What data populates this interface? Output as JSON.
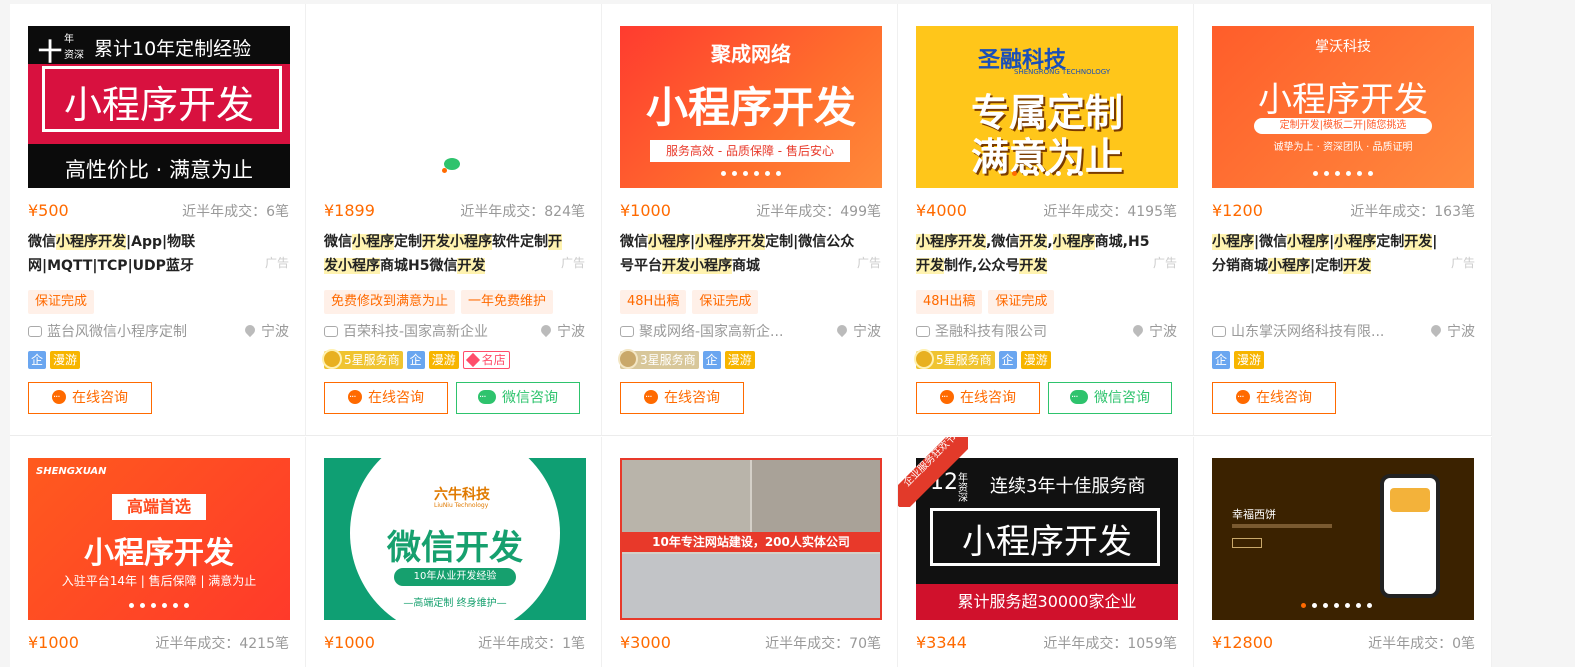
{
  "colors": {
    "accent": "#ff6a00",
    "wechat": "#2ec36d",
    "highlight": "#fff3b0"
  },
  "labels": {
    "deals_prefix": "近半年成交：",
    "ad": "广告",
    "btn_online": "在线咨询",
    "btn_wechat": "微信咨询",
    "qi": "企",
    "manyou": "漫游"
  },
  "cards": [
    {
      "price": "¥500",
      "deals": "近半年成交：6笔",
      "title_parts": [
        [
          "微信",
          false
        ],
        [
          "小程序开发",
          true
        ],
        [
          "|App|物联网|MQTT|TCP|UDP蓝牙",
          false
        ]
      ],
      "tags": [
        "保证完成"
      ],
      "company": "蓝台风微信小程序定制",
      "location": "宁波",
      "badges": [
        "企",
        "漫游"
      ],
      "buttons": [
        "online"
      ],
      "thumb": {
        "tl": "十",
        "tl2": "年",
        "tl3": "资深",
        "top": "累计10年定制经验",
        "main": "小程序开发",
        "bottom": "高性价比 · 满意为止"
      }
    },
    {
      "price": "¥1899",
      "deals": "近半年成交：824笔",
      "title_parts": [
        [
          "微信",
          false
        ],
        [
          "小程序",
          true
        ],
        [
          "定制",
          false
        ],
        [
          "开发小程序",
          true
        ],
        [
          "软件定制",
          false
        ],
        [
          "开发小程序",
          true
        ],
        [
          "商城H5微信",
          false
        ],
        [
          "开发",
          true
        ]
      ],
      "tags": [
        "免费修改到满意为止",
        "一年免费维护"
      ],
      "company": "百荣科技-国家高新企业",
      "location": "宁波",
      "badges": [
        "5星服务商",
        "企",
        "漫游",
        "名店"
      ],
      "buttons": [
        "online",
        "wechat"
      ],
      "thumb": {}
    },
    {
      "price": "¥1000",
      "deals": "近半年成交：499笔",
      "title_parts": [
        [
          "微信",
          false
        ],
        [
          "小程序",
          true
        ],
        [
          "|",
          false
        ],
        [
          "小程序开发",
          true
        ],
        [
          "定制|微信公众号平台",
          false
        ],
        [
          "开发小程序",
          true
        ],
        [
          "商城",
          false
        ]
      ],
      "tags": [
        "48H出稿",
        "保证完成"
      ],
      "company": "聚成网络-国家高新企...",
      "location": "宁波",
      "badges": [
        "3星服务商",
        "企",
        "漫游"
      ],
      "buttons": [
        "online"
      ],
      "thumb": {
        "top": "聚成网络",
        "main": "小程序开发",
        "bottom": "服务高效 - 品质保障 - 售后安心"
      }
    },
    {
      "price": "¥4000",
      "deals": "近半年成交：4195笔",
      "title_parts": [
        [
          "小程序开发",
          true
        ],
        [
          ",微信",
          false
        ],
        [
          "开发",
          true
        ],
        [
          ",",
          false
        ],
        [
          "小程序",
          true
        ],
        [
          "商城,H5",
          false
        ],
        [
          "开发",
          true
        ],
        [
          "制作,公众号",
          false
        ],
        [
          "开发",
          true
        ]
      ],
      "tags": [
        "48H出稿",
        "保证完成"
      ],
      "company": "圣融科技有限公司",
      "location": "宁波",
      "badges": [
        "5星服务商",
        "企",
        "漫游"
      ],
      "buttons": [
        "online",
        "wechat"
      ],
      "thumb": {
        "top": "圣融科技",
        "sub": "SHENGRONG TECHNOLOGY",
        "main": "专属定制",
        "main2": "满意为止"
      }
    },
    {
      "price": "¥1200",
      "deals": "近半年成交：163笔",
      "title_parts": [
        [
          "小程序",
          true
        ],
        [
          "|微信",
          false
        ],
        [
          "小程序",
          true
        ],
        [
          "|",
          false
        ],
        [
          "小程序",
          true
        ],
        [
          "定制",
          false
        ],
        [
          "开发",
          true
        ],
        [
          "|分销商城",
          false
        ],
        [
          "小程序",
          true
        ],
        [
          "|定制",
          false
        ],
        [
          "开发",
          true
        ]
      ],
      "tags": [],
      "company": "山东掌沃网络科技有限...",
      "location": "宁波",
      "badges": [
        "企",
        "漫游"
      ],
      "buttons": [
        "online"
      ],
      "thumb": {
        "top": "掌沃科技",
        "main": "小程序开发",
        "bottom": "定制开发|模板二开|随您挑选",
        "bottom2": "诚挚为上 · 资深团队 · 品质证明"
      }
    }
  ],
  "cards_row2": [
    {
      "price": "¥1000",
      "deals": "近半年成交：4215笔",
      "thumb": {
        "logo": "SHENGXUAN",
        "top": "高端首选",
        "main": "小程序开发",
        "bottom": "入驻平台14年 | 售后保障 | 满意为止"
      }
    },
    {
      "price": "¥1000",
      "deals": "近半年成交：1笔",
      "thumb": {
        "top": "六牛科技",
        "sub": "LiuNiu Technology",
        "main": "微信开发",
        "bottom": "10年从业开发经验",
        "bottom2": "—高端定制  终身维护—"
      }
    },
    {
      "price": "¥3000",
      "deals": "近半年成交：70笔",
      "thumb": {
        "bottom": "10年专注网站建设，200人实体公司"
      }
    },
    {
      "price": "¥3344",
      "deals": "近半年成交：1059笔",
      "thumb": {
        "ribbon": "企业服务狂欢节",
        "tl": "12",
        "tl2": "年资深",
        "top": "连续3年十佳服务商",
        "main": "小程序开发",
        "bottom": "累计服务超30000家企业"
      }
    },
    {
      "price": "¥12800",
      "deals": "近半年成交：0笔",
      "thumb": {
        "top": "幸福西饼"
      }
    }
  ]
}
